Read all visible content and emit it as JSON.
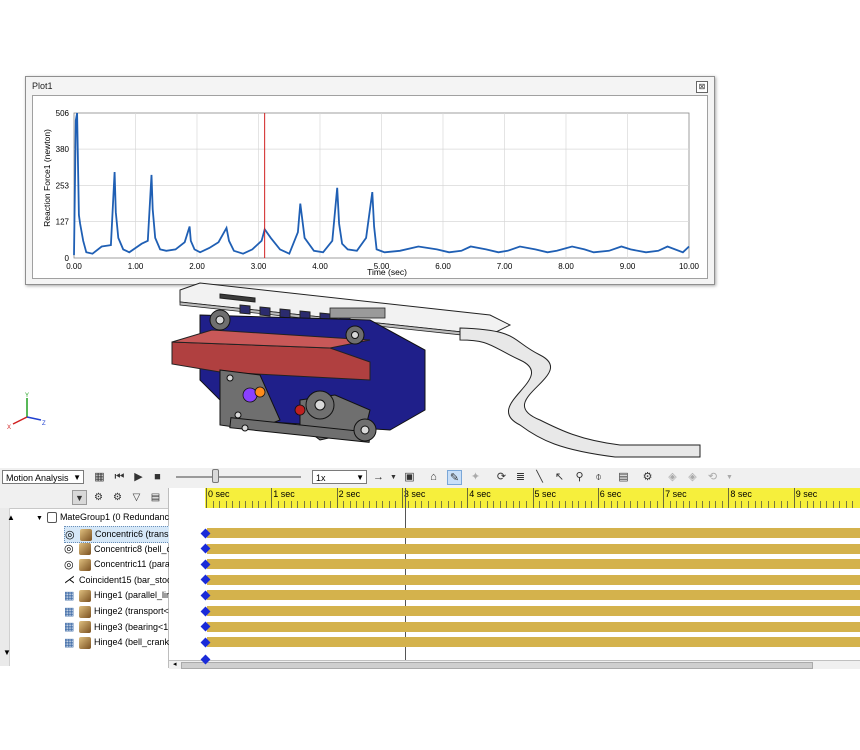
{
  "plot": {
    "title": "Plot1",
    "close_glyph": "⊠",
    "ylabel": "Reaction Force1 (newton)",
    "xlabel": "Time (sec)",
    "y_ticks": [
      "0",
      "127",
      "253",
      "380",
      "506"
    ],
    "x_ticks": [
      "0.00",
      "1.00",
      "2.00",
      "3.00",
      "4.00",
      "5.00",
      "6.00",
      "7.00",
      "8.00",
      "9.00",
      "10.00"
    ],
    "marker_time": 3.1,
    "line_color": "#1f5fb4",
    "marker_color": "#d02020"
  },
  "chart_data": {
    "type": "line",
    "xlabel": "Time (sec)",
    "ylabel": "Reaction Force1 (newton)",
    "xlim": [
      0,
      10
    ],
    "ylim": [
      0,
      506
    ],
    "grid": true,
    "series": [
      {
        "x": [
          0,
          0.03,
          0.05,
          0.08,
          0.1,
          0.15,
          0.2,
          0.3,
          0.45,
          0.6,
          0.66,
          0.68,
          0.72,
          0.8,
          0.9,
          1.0,
          1.1,
          1.2,
          1.26,
          1.28,
          1.32,
          1.4,
          1.5,
          1.65,
          1.8,
          1.88,
          1.9,
          1.96,
          2.05,
          2.2,
          2.35,
          2.48,
          2.52,
          2.6,
          2.75,
          2.9,
          3.05,
          3.1,
          3.2,
          3.35,
          3.5,
          3.64,
          3.68,
          3.75,
          3.9,
          4.05,
          4.2,
          4.28,
          4.31,
          4.36,
          4.45,
          4.6,
          4.75,
          4.85,
          4.88,
          4.92,
          5.05,
          5.3,
          5.6,
          5.9,
          6.1,
          6.3,
          6.45,
          6.7,
          6.9,
          7.05,
          7.25,
          7.5,
          7.7,
          7.85,
          8.1,
          8.3,
          8.45,
          8.7,
          8.9,
          9.05,
          9.3,
          9.5,
          9.65,
          9.9,
          10.0
        ],
        "y": [
          10,
          480,
          506,
          150,
          120,
          60,
          20,
          15,
          40,
          45,
          300,
          160,
          70,
          30,
          20,
          35,
          50,
          60,
          290,
          170,
          70,
          30,
          25,
          30,
          55,
          110,
          60,
          30,
          20,
          35,
          55,
          105,
          60,
          25,
          15,
          30,
          60,
          100,
          70,
          30,
          15,
          90,
          190,
          70,
          25,
          20,
          60,
          245,
          120,
          50,
          30,
          25,
          70,
          230,
          110,
          30,
          20,
          25,
          40,
          30,
          20,
          25,
          40,
          30,
          20,
          25,
          40,
          30,
          20,
          25,
          40,
          30,
          20,
          25,
          40,
          30,
          20,
          25,
          40,
          20,
          40
        ]
      }
    ]
  },
  "motion_toolbar": {
    "study_type": "Motion Analysis",
    "speed": "1x"
  },
  "timeline": {
    "labels": [
      "0 sec",
      "1 sec",
      "2 sec",
      "3 sec",
      "4 sec",
      "5 sec",
      "6 sec",
      "7 sec",
      "8 sec",
      "9 sec"
    ],
    "key_color": "#d4b24c",
    "ruler_color": "#f6ef3c"
  },
  "tree": {
    "group": "MateGroup1 (0 Redundanc",
    "items": [
      {
        "label": "Concentric6 (trans",
        "icon": "concentric-mate-icon"
      },
      {
        "label": "Concentric8 (bell_c",
        "icon": "concentric-mate-icon"
      },
      {
        "label": "Concentric11 (para",
        "icon": "concentric-mate-icon"
      },
      {
        "label": "Coincident15 (bar_stoc",
        "icon": "coincident-mate-icon"
      },
      {
        "label": "Hinge1 (parallel_lin",
        "icon": "hinge-mate-icon"
      },
      {
        "label": "Hinge2 (transport<",
        "icon": "hinge-mate-icon"
      },
      {
        "label": "Hinge3 (bearing<1",
        "icon": "hinge-mate-icon"
      },
      {
        "label": "Hinge4 (bell_crank",
        "icon": "hinge-mate-icon"
      }
    ]
  }
}
